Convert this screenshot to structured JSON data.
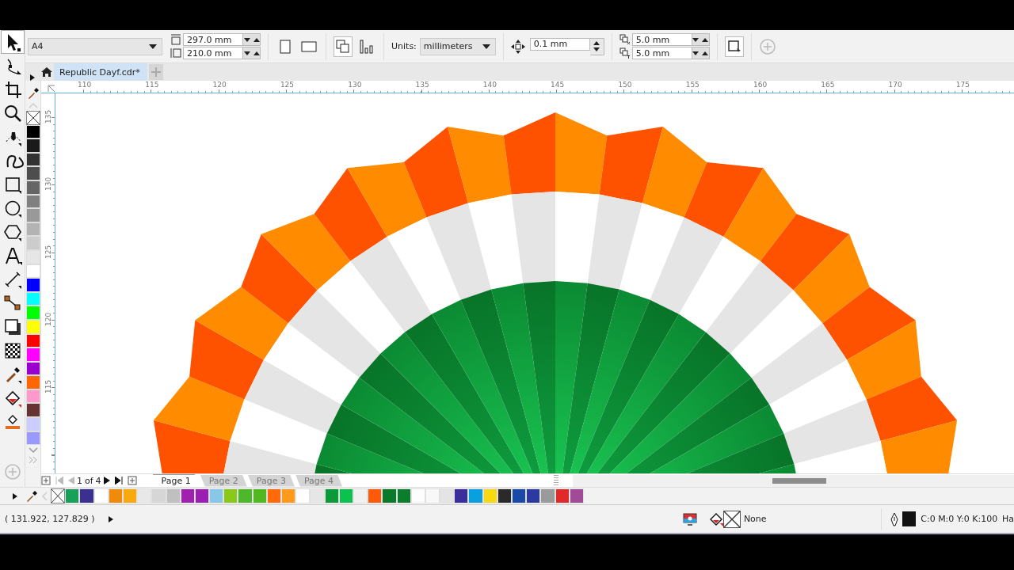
{
  "toolbar": {
    "page_size": "A4",
    "page_width": "297.0 mm",
    "page_height": "210.0 mm",
    "units_label": "Units:",
    "units": "millimeters",
    "nudge": "0.1 mm",
    "duplicate_x": "5.0 mm",
    "duplicate_y": "5.0 mm"
  },
  "toolbox": [
    {
      "kind": "pick",
      "selected": true
    },
    {
      "kind": "shape",
      "selected": false
    },
    {
      "kind": "crop",
      "selected": false
    },
    {
      "kind": "zoom",
      "selected": false
    },
    {
      "kind": "pen",
      "selected": false
    },
    {
      "kind": "curve",
      "selected": false
    },
    {
      "kind": "rectangle",
      "selected": false
    },
    {
      "kind": "ellipse",
      "selected": false
    },
    {
      "kind": "polygon",
      "selected": false
    },
    {
      "kind": "text",
      "selected": false
    },
    {
      "kind": "dimension",
      "selected": false
    },
    {
      "kind": "connector",
      "selected": false
    },
    {
      "kind": "shadow",
      "selected": false
    },
    {
      "kind": "transparency",
      "selected": false
    },
    {
      "kind": "eyedropper",
      "selected": false
    },
    {
      "kind": "fill",
      "selected": false
    },
    {
      "kind": "smartfill",
      "selected": false
    },
    {
      "kind": "add",
      "selected": false
    }
  ],
  "document_tabs": [
    {
      "title": "Republic Dayf.cdr*",
      "selected": true
    }
  ],
  "horizontal_ruler": [
    "110",
    "115",
    "120",
    "125",
    "130",
    "135",
    "140",
    "145",
    "150",
    "155",
    "160",
    "165",
    "170",
    "175"
  ],
  "vertical_ruler": [
    "135",
    "130",
    "125",
    "120",
    "115"
  ],
  "color_palette": [
    {
      "kind": "none"
    },
    {
      "kind": "color",
      "color": "#000000"
    },
    {
      "kind": "color",
      "color": "#1a1a1a"
    },
    {
      "kind": "color",
      "color": "#333333"
    },
    {
      "kind": "color",
      "color": "#4d4d4d"
    },
    {
      "kind": "color",
      "color": "#666666"
    },
    {
      "kind": "color",
      "color": "#808080"
    },
    {
      "kind": "color",
      "color": "#999999"
    },
    {
      "kind": "color",
      "color": "#b3b3b3"
    },
    {
      "kind": "color",
      "color": "#cccccc"
    },
    {
      "kind": "color",
      "color": "#e6e6e6"
    },
    {
      "kind": "color",
      "color": "#ffffff"
    },
    {
      "kind": "color",
      "color": "#0000ff"
    },
    {
      "kind": "color",
      "color": "#00ffff"
    },
    {
      "kind": "color",
      "color": "#00ff00"
    },
    {
      "kind": "color",
      "color": "#ffff00"
    },
    {
      "kind": "color",
      "color": "#ff0000"
    },
    {
      "kind": "color",
      "color": "#ff00ff"
    },
    {
      "kind": "color",
      "color": "#9900cc"
    },
    {
      "kind": "color",
      "color": "#ff6600"
    },
    {
      "kind": "color",
      "color": "#ff99cc"
    },
    {
      "kind": "color",
      "color": "#663333"
    },
    {
      "kind": "color",
      "color": "#ccccff"
    },
    {
      "kind": "color",
      "color": "#9999ff"
    }
  ],
  "page_navigator": {
    "current": "1",
    "of": "of",
    "total": "4",
    "pages": [
      {
        "label": "Page 1",
        "selected": true
      },
      {
        "label": "Page 2",
        "selected": false
      },
      {
        "label": "Page 3",
        "selected": false
      },
      {
        "label": "Page 4",
        "selected": false
      }
    ]
  },
  "document_palette": [
    {
      "kind": "none"
    },
    {
      "kind": "color",
      "color": "#16a05a"
    },
    {
      "kind": "color",
      "color": "#3b2f8f"
    },
    {
      "kind": "color",
      "color": "#ffffff"
    },
    {
      "kind": "color",
      "color": "#f08a0b"
    },
    {
      "kind": "color",
      "color": "#f7a90f"
    },
    {
      "kind": "color",
      "color": "#e8e8e8"
    },
    {
      "kind": "color",
      "color": "#d6d6d6"
    },
    {
      "kind": "color",
      "color": "#c0c0c0"
    },
    {
      "kind": "color",
      "color": "#a020b0"
    },
    {
      "kind": "color",
      "color": "#9b1fb0"
    },
    {
      "kind": "color",
      "color": "#87c8e8"
    },
    {
      "kind": "color",
      "color": "#8ac81a"
    },
    {
      "kind": "color",
      "color": "#4cb82a"
    },
    {
      "kind": "color",
      "color": "#52b81f"
    },
    {
      "kind": "color",
      "color": "#ff6a0a"
    },
    {
      "kind": "color",
      "color": "#ff9a1a"
    },
    {
      "kind": "color",
      "color": "#fefefe"
    },
    {
      "kind": "color",
      "color": "#e6e6e6"
    },
    {
      "kind": "color",
      "color": "#0b9a3a"
    },
    {
      "kind": "color",
      "color": "#0cc24e"
    },
    {
      "kind": "color",
      "color": "#f0f0f0"
    },
    {
      "kind": "color",
      "color": "#ff5a0a"
    },
    {
      "kind": "color",
      "color": "#0a7a2a"
    },
    {
      "kind": "color",
      "color": "#0b7d2c"
    },
    {
      "kind": "color",
      "color": "#fdfdfd"
    },
    {
      "kind": "color",
      "color": "#f8f8f8"
    },
    {
      "kind": "color",
      "color": "#e4e4e4"
    },
    {
      "kind": "color",
      "color": "#3a2f9a"
    },
    {
      "kind": "color",
      "color": "#0aa0e0"
    },
    {
      "kind": "color",
      "color": "#f8d810"
    },
    {
      "kind": "color",
      "color": "#2a2a2a"
    },
    {
      "kind": "color",
      "color": "#1a4aa8"
    },
    {
      "kind": "color",
      "color": "#2a3aa0"
    },
    {
      "kind": "color",
      "color": "#9a9a9a"
    },
    {
      "kind": "color",
      "color": "#e02a2a"
    },
    {
      "kind": "color",
      "color": "#a04a98"
    }
  ],
  "status_bar": {
    "cursor_position": "( 131.922, 127.829 )",
    "fill": "None",
    "outline": "C:0 M:0 Y:0 K:100",
    "outline_width": "Ha"
  }
}
